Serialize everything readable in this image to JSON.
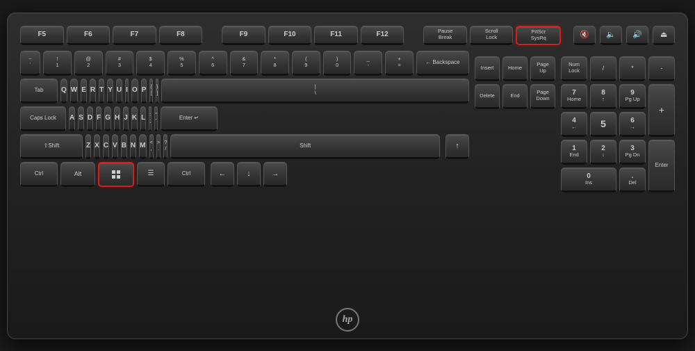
{
  "keyboard": {
    "brand": "hp",
    "rows": {
      "fn_row": {
        "keys": [
          "F5",
          "F6",
          "F7",
          "F8",
          "F9",
          "F10",
          "F11",
          "F12"
        ]
      },
      "special_keys": [
        "Pause\nBreak",
        "Scroll\nLock",
        "PrtScr\nSysRq"
      ],
      "number_row": [
        "~\n`",
        "!\n1",
        "@\n2",
        "#\n3",
        "$\n4",
        "%\n5",
        "^\n6",
        "&\n7",
        "*\n8",
        "(\n9",
        ")\n0",
        "_\n-",
        "+\n=",
        "Backspace"
      ],
      "top_alpha": [
        "Tab",
        "Q",
        "W",
        "E",
        "R",
        "T",
        "Y",
        "U",
        "I",
        "O",
        "P",
        "{\n[",
        "}\n]",
        "|\n\\"
      ],
      "mid_alpha": [
        "Caps Lock",
        "A",
        "S",
        "D",
        "F",
        "G",
        "H",
        "J",
        "K",
        "L",
        ":\n;",
        "\"\n'",
        "Enter"
      ],
      "bot_alpha": [
        "Shift",
        "Z",
        "X",
        "C",
        "V",
        "B",
        "N",
        "M",
        "<\n,",
        ">\n.",
        "?\n/",
        "Shift"
      ],
      "bottom_row": [
        "Ctrl",
        "Alt",
        "Win",
        "Menu",
        "Ctrl"
      ]
    },
    "nav_keys": [
      "Insert",
      "Home",
      "Page\nUp",
      "Delete",
      "End",
      "Page\nDown"
    ],
    "arrow_keys": [
      "↑",
      "←",
      "↓",
      "→"
    ],
    "numpad": {
      "top": [
        "Num\nLock",
        "/",
        "*",
        "-"
      ],
      "row2": [
        "7\nHome",
        "8\n↑",
        "9\nPg Up",
        "+"
      ],
      "row3": [
        "4\n←",
        "5",
        "6\n→"
      ],
      "row4": [
        "1\nEnd",
        "2\n↓",
        "3\nPg Dn",
        "Enter"
      ],
      "row5": [
        "0\nIns",
        ".\nDel"
      ]
    },
    "media_icons": [
      "🔇",
      "🔉",
      "🔊",
      "⏏"
    ]
  }
}
